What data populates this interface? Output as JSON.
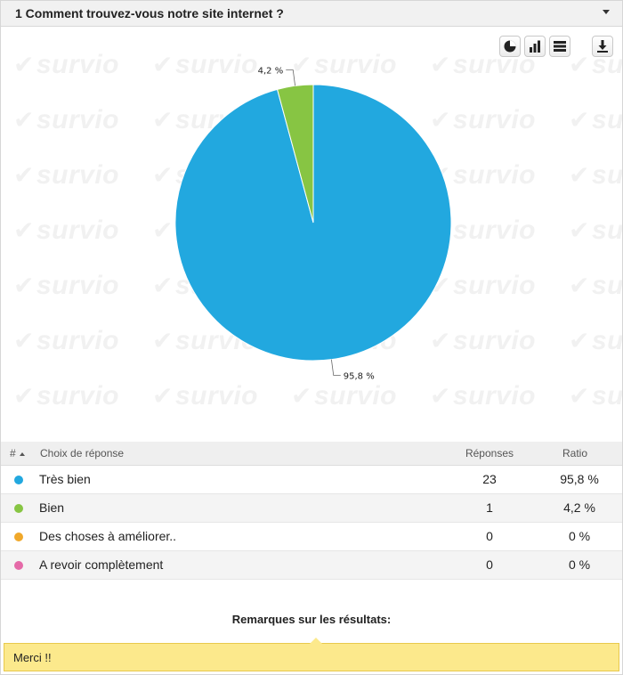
{
  "question": {
    "number": "1",
    "title": "1 Comment trouvez-vous notre site internet ?"
  },
  "watermark_text": "survio",
  "toolbar": {
    "icons": [
      "pie-chart-icon",
      "bar-chart-icon",
      "table-icon",
      "download-icon"
    ]
  },
  "chart_data": {
    "type": "pie",
    "categories": [
      "Très bien",
      "Bien",
      "Des choses à améliorer..",
      "A revoir complètement"
    ],
    "values": [
      95.8,
      4.2,
      0,
      0
    ],
    "counts": [
      23,
      1,
      0,
      0
    ],
    "colors": [
      "#22a8df",
      "#87c543",
      "#f0a82a",
      "#e56aa8"
    ],
    "data_labels": [
      "95,8 %",
      "4,2 %",
      "",
      ""
    ]
  },
  "table": {
    "headers": {
      "index": "#",
      "choice": "Choix de réponse",
      "responses": "Réponses",
      "ratio": "Ratio"
    },
    "rows": [
      {
        "label": "Très bien",
        "count": "23",
        "ratio": "95,8 %",
        "color": "#22a8df"
      },
      {
        "label": "Bien",
        "count": "1",
        "ratio": "4,2 %",
        "color": "#87c543"
      },
      {
        "label": "Des choses à améliorer..",
        "count": "0",
        "ratio": "0 %",
        "color": "#f0a82a"
      },
      {
        "label": "A revoir complètement",
        "count": "0",
        "ratio": "0 %",
        "color": "#e56aa8"
      }
    ]
  },
  "remarks": {
    "title": "Remarques sur les résultats:",
    "text": "Merci !!"
  }
}
